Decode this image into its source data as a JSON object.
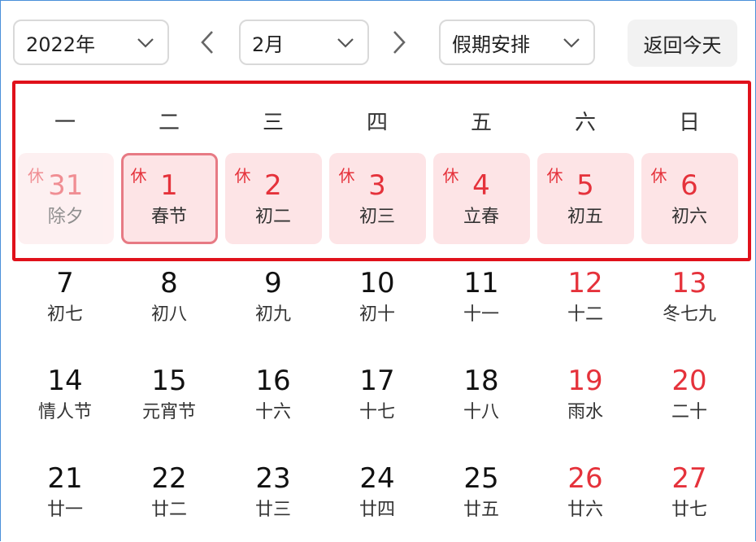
{
  "toolbar": {
    "year": "2022年",
    "month": "2月",
    "holiday": "假期安排",
    "today": "返回今天"
  },
  "weekdays": [
    "一",
    "二",
    "三",
    "四",
    "五",
    "六",
    "日"
  ],
  "rest_mark": "休",
  "days": [
    {
      "num": "31",
      "lunar": "除夕",
      "rest": true,
      "holiday": true,
      "prev": true
    },
    {
      "num": "1",
      "lunar": "春节",
      "rest": true,
      "holiday": true,
      "selected": true
    },
    {
      "num": "2",
      "lunar": "初二",
      "rest": true,
      "holiday": true
    },
    {
      "num": "3",
      "lunar": "初三",
      "rest": true,
      "holiday": true
    },
    {
      "num": "4",
      "lunar": "立春",
      "rest": true,
      "holiday": true
    },
    {
      "num": "5",
      "lunar": "初五",
      "rest": true,
      "holiday": true
    },
    {
      "num": "6",
      "lunar": "初六",
      "rest": true,
      "holiday": true
    },
    {
      "num": "7",
      "lunar": "初七"
    },
    {
      "num": "8",
      "lunar": "初八"
    },
    {
      "num": "9",
      "lunar": "初九"
    },
    {
      "num": "10",
      "lunar": "初十"
    },
    {
      "num": "11",
      "lunar": "十一"
    },
    {
      "num": "12",
      "lunar": "十二",
      "red": true
    },
    {
      "num": "13",
      "lunar": "冬七九",
      "red": true
    },
    {
      "num": "14",
      "lunar": "情人节"
    },
    {
      "num": "15",
      "lunar": "元宵节"
    },
    {
      "num": "16",
      "lunar": "十六"
    },
    {
      "num": "17",
      "lunar": "十七"
    },
    {
      "num": "18",
      "lunar": "十八"
    },
    {
      "num": "19",
      "lunar": "雨水",
      "red": true
    },
    {
      "num": "20",
      "lunar": "二十",
      "red": true
    },
    {
      "num": "21",
      "lunar": "廿一"
    },
    {
      "num": "22",
      "lunar": "廿二"
    },
    {
      "num": "23",
      "lunar": "廿三"
    },
    {
      "num": "24",
      "lunar": "廿四"
    },
    {
      "num": "25",
      "lunar": "廿五"
    },
    {
      "num": "26",
      "lunar": "廿六",
      "red": true
    },
    {
      "num": "27",
      "lunar": "廿七",
      "red": true
    }
  ],
  "colors": {
    "accent_red": "#e5323b",
    "holiday_bg": "#fde4e6",
    "highlight_border": "#e0111b"
  }
}
